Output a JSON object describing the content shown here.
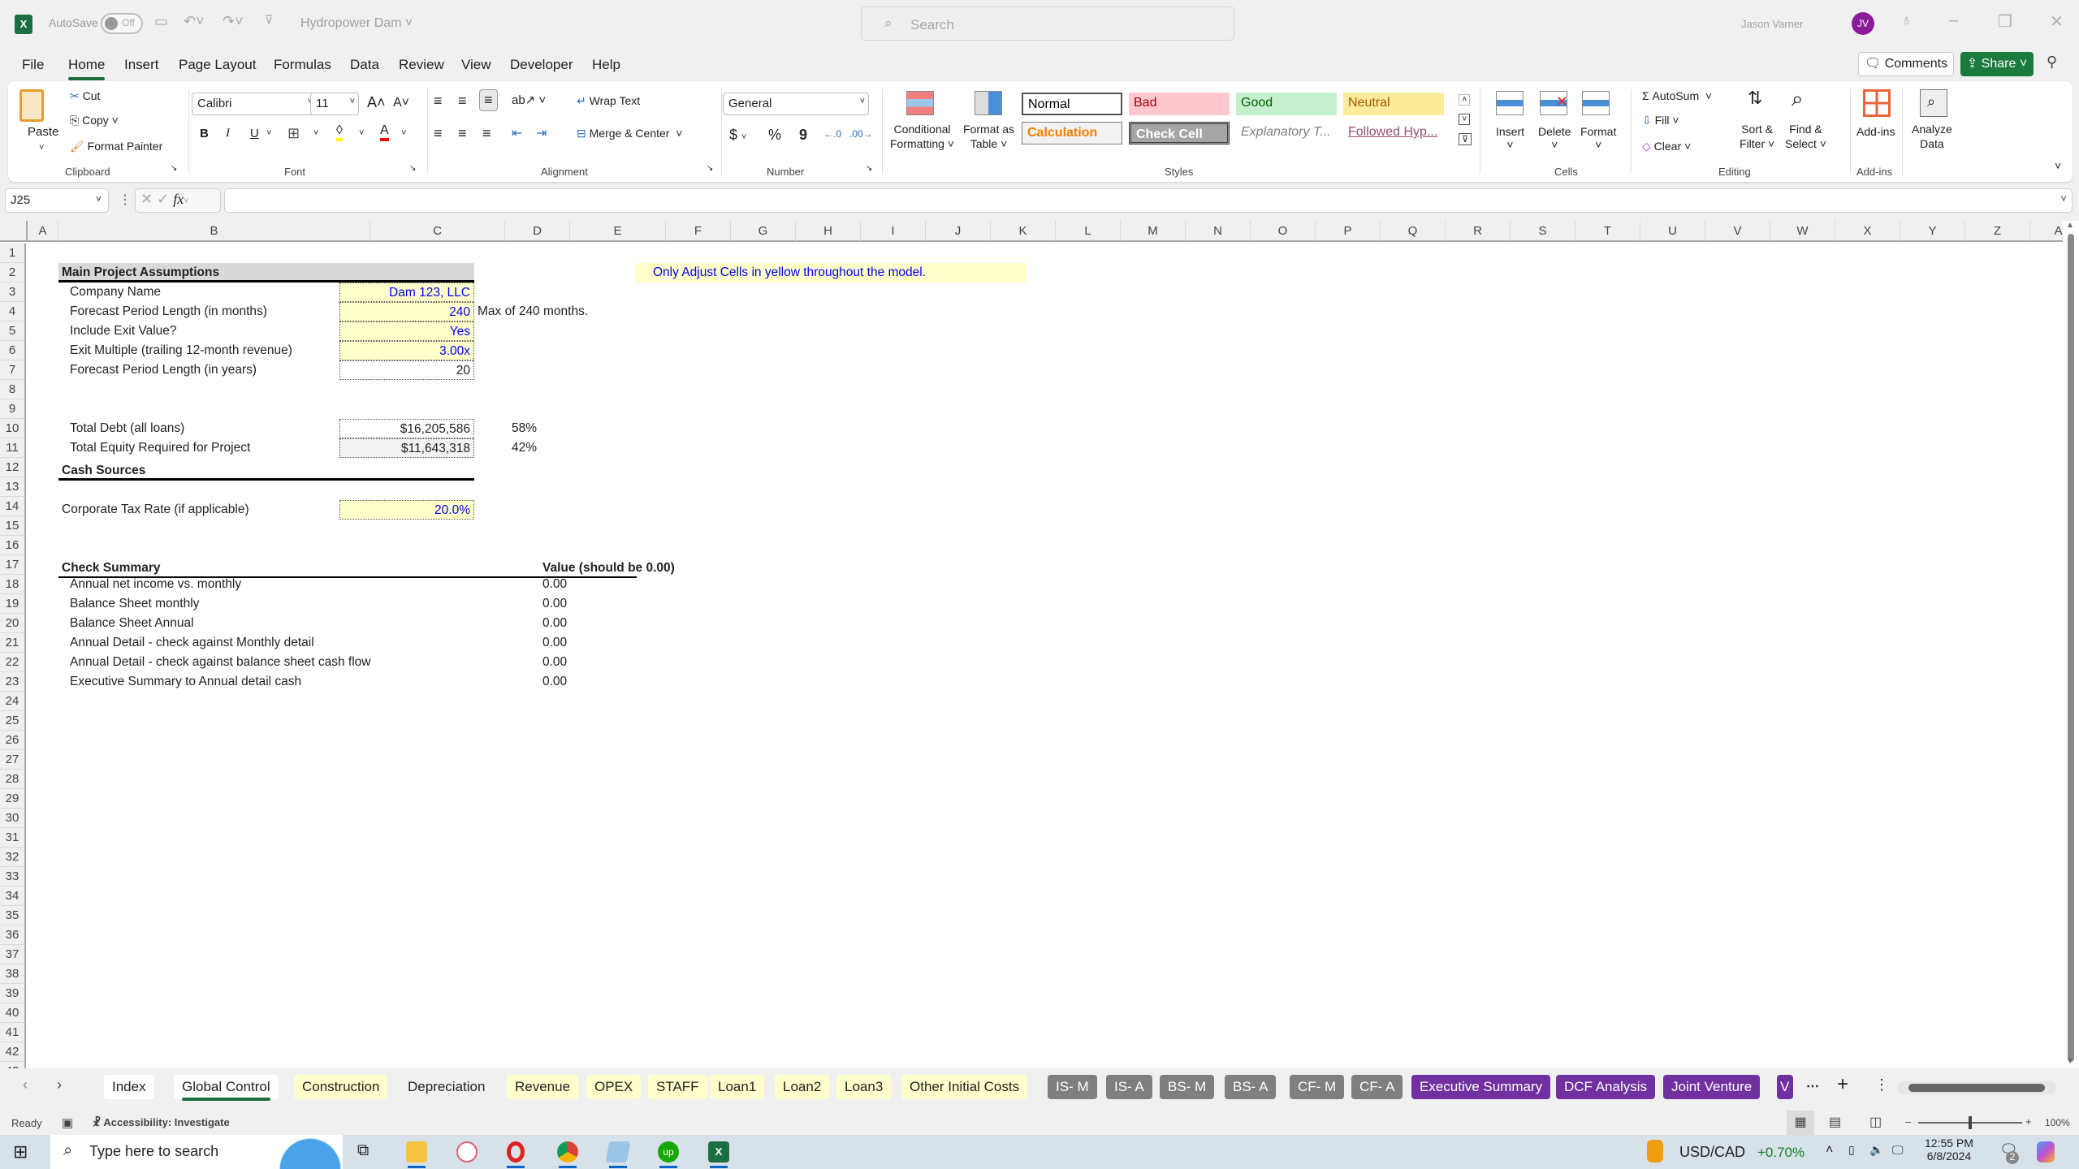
{
  "window": {
    "app_icon": "excel-logo",
    "autosave_label": "AutoSave",
    "autosave_state": "Off",
    "doc_title": "Hydropower Dam",
    "search_placeholder": "Search",
    "user_name": "Jason Varner",
    "user_initials": "JV"
  },
  "menu": {
    "tabs": [
      "File",
      "Home",
      "Insert",
      "Page Layout",
      "Formulas",
      "Data",
      "Review",
      "View",
      "Developer",
      "Help"
    ],
    "active": "Home",
    "comments_label": "Comments",
    "share_label": "Share"
  },
  "ribbon": {
    "clipboard": {
      "paste": "Paste",
      "cut": "Cut",
      "copy": "Copy",
      "format_painter": "Format Painter",
      "label": "Clipboard"
    },
    "font": {
      "name": "Calibri",
      "size": "11",
      "label": "Font",
      "bold": "B",
      "italic": "I",
      "underline": "U",
      "fill_color": "#ffff00",
      "font_color": "#ff0000"
    },
    "alignment": {
      "wrap_text": "Wrap Text",
      "merge_center": "Merge & Center",
      "label": "Alignment"
    },
    "number": {
      "format": "General",
      "label": "Number",
      "currency": "$",
      "percent": "%",
      "comma": "9"
    },
    "styles": {
      "conditional_formatting": [
        "Conditional",
        "Formatting"
      ],
      "format_as_table": [
        "Format as",
        "Table"
      ],
      "label": "Styles",
      "gallery": [
        {
          "name": "Normal",
          "bg": "#ffffff",
          "color": "#000000"
        },
        {
          "name": "Bad",
          "bg": "#ffc7ce",
          "color": "#9c0006"
        },
        {
          "name": "Good",
          "bg": "#c6efce",
          "color": "#006100"
        },
        {
          "name": "Neutral",
          "bg": "#ffeb9c",
          "color": "#9c5700"
        },
        {
          "name": "Calculation",
          "bg": "#f2f2f2",
          "color": "#fa7d00"
        },
        {
          "name": "Check Cell",
          "bg": "#a5a5a5",
          "color": "#ffffff"
        },
        {
          "name": "Explanatory T...",
          "bg": "#ffffff",
          "color": "#7f7f7f"
        },
        {
          "name": "Followed Hyp...",
          "bg": "#ffffff",
          "color": "#954f72"
        }
      ]
    },
    "cells": {
      "insert": "Insert",
      "delete": "Delete",
      "format": "Format",
      "label": "Cells"
    },
    "editing": {
      "autosum": "AutoSum",
      "fill": "Fill",
      "clear": "Clear",
      "sort_filter": [
        "Sort &",
        "Filter"
      ],
      "find_select": [
        "Find &",
        "Select"
      ],
      "label": "Editing"
    },
    "addins": {
      "addins": "Add-ins",
      "analyze": [
        "Analyze",
        "Data"
      ],
      "label": "Add-ins"
    }
  },
  "formula_bar": {
    "name_box": "J25",
    "formula": ""
  },
  "columns": [
    "A",
    "B",
    "C",
    "D",
    "E",
    "F",
    "G",
    "H",
    "I",
    "J",
    "K",
    "L",
    "M",
    "N",
    "O",
    "P",
    "Q",
    "R",
    "S",
    "T",
    "U",
    "V",
    "W",
    "X",
    "Y",
    "Z",
    "AA"
  ],
  "rows_visible": 42,
  "sheet": {
    "note": "Only Adjust Cells in yellow throughout the model.",
    "main_assumptions": {
      "header": "Main Project Assumptions",
      "rows": [
        {
          "label": "Company Name",
          "value": "Dam 123, LLC",
          "input": true
        },
        {
          "label": "Forecast Period Length (in months)",
          "value": "240",
          "input": true,
          "note": "Max of 240 months."
        },
        {
          "label": "Include Exit Value?",
          "value": "Yes",
          "input": true
        },
        {
          "label": "Exit Multiple (trailing 12-month revenue)",
          "value": "3.00x",
          "input": true
        },
        {
          "label": "Forecast Period Length (in years)",
          "value": "20",
          "input": false
        }
      ]
    },
    "cash_sources": {
      "header": "Cash Sources",
      "rows": [
        {
          "label": "Total Debt (all loans)",
          "value": "$16,205,586",
          "pct": "58%"
        },
        {
          "label": "Total Equity Required for Project",
          "value": "$11,643,318",
          "pct": "42%"
        }
      ]
    },
    "tax": {
      "label": "Corporate Tax Rate (if applicable)",
      "value": "20.0%"
    },
    "check_summary": {
      "header": "Check Summary",
      "value_header": "Value (should be 0.00)",
      "rows": [
        {
          "label": "Annual net income vs. monthly",
          "value": "0.00"
        },
        {
          "label": "Balance Sheet monthly",
          "value": "0.00"
        },
        {
          "label": "Balance Sheet Annual",
          "value": "0.00"
        },
        {
          "label": "Annual Detail - check against Monthly detail",
          "value": "0.00"
        },
        {
          "label": "Annual Detail - check against balance sheet cash flow",
          "value": "0.00"
        },
        {
          "label": "Executive Summary to Annual detail cash",
          "value": "0.00"
        }
      ]
    }
  },
  "sheet_tabs": [
    {
      "name": "Index",
      "style": "white"
    },
    {
      "name": "Global Control",
      "style": "active"
    },
    {
      "name": "Construction",
      "style": "yellow"
    },
    {
      "name": "Depreciation",
      "style": "plain"
    },
    {
      "name": "Revenue",
      "style": "yellow"
    },
    {
      "name": "OPEX",
      "style": "yellow"
    },
    {
      "name": "STAFF",
      "style": "yellow"
    },
    {
      "name": "Loan1",
      "style": "yellow"
    },
    {
      "name": "Loan2",
      "style": "yellow"
    },
    {
      "name": "Loan3",
      "style": "yellow"
    },
    {
      "name": "Other Initial Costs",
      "style": "yellow"
    },
    {
      "name": "IS- M",
      "style": "gray"
    },
    {
      "name": "IS- A",
      "style": "gray"
    },
    {
      "name": "BS- M",
      "style": "gray"
    },
    {
      "name": "BS- A",
      "style": "gray"
    },
    {
      "name": "CF- M",
      "style": "gray"
    },
    {
      "name": "CF- A",
      "style": "gray"
    },
    {
      "name": "Executive Summary",
      "style": "purple"
    },
    {
      "name": "DCF Analysis",
      "style": "purple"
    },
    {
      "name": "Joint Venture",
      "style": "purple"
    },
    {
      "name": "V",
      "style": "purple"
    }
  ],
  "status": {
    "mode": "Ready",
    "accessibility": "Accessibility: Investigate",
    "zoom": "100%"
  },
  "taskbar": {
    "search_placeholder": "Type here to search",
    "ticker": "USD/CAD",
    "ticker_change": "+0.70%",
    "time": "12:55 PM",
    "date": "6/8/2024",
    "notifications": "2"
  }
}
